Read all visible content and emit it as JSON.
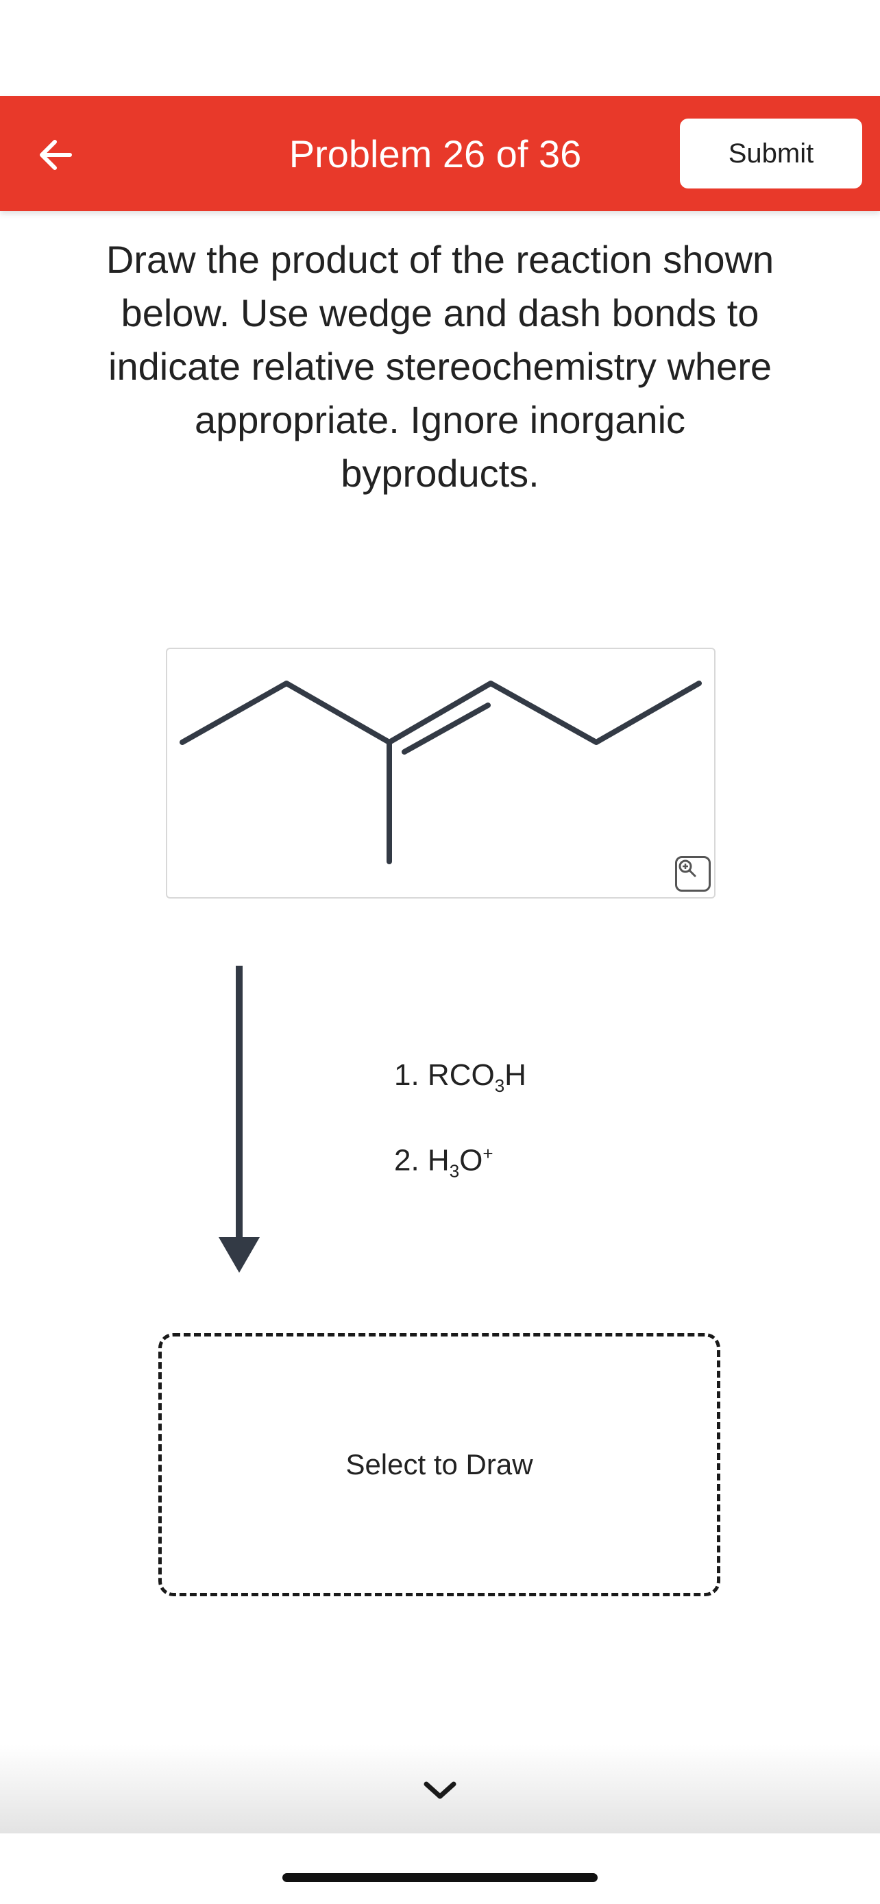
{
  "header": {
    "title": "Problem 26 of 36",
    "submit_label": "Submit",
    "back_icon": "arrow-left-icon",
    "background_color": "#e8392a"
  },
  "question": {
    "lines": [
      "Draw the product of the reaction shown",
      "below. Use wedge and dash bonds to",
      "indicate relative stereochemistry where",
      "appropriate. Ignore inorganic",
      "byproducts."
    ]
  },
  "reactant": {
    "structure": "3-methyl-3-hexene skeletal structure",
    "zoom_icon": "zoom-in-icon"
  },
  "reagents": {
    "step1": {
      "prefix": "1. RCO",
      "sub": "3",
      "suffix": "H"
    },
    "step2": {
      "prefix": "2. H",
      "sub": "3",
      "mid": "O",
      "sup": "+"
    }
  },
  "answer_box": {
    "label": "Select to Draw"
  },
  "footer": {
    "chevron_icon": "chevron-down-icon"
  }
}
